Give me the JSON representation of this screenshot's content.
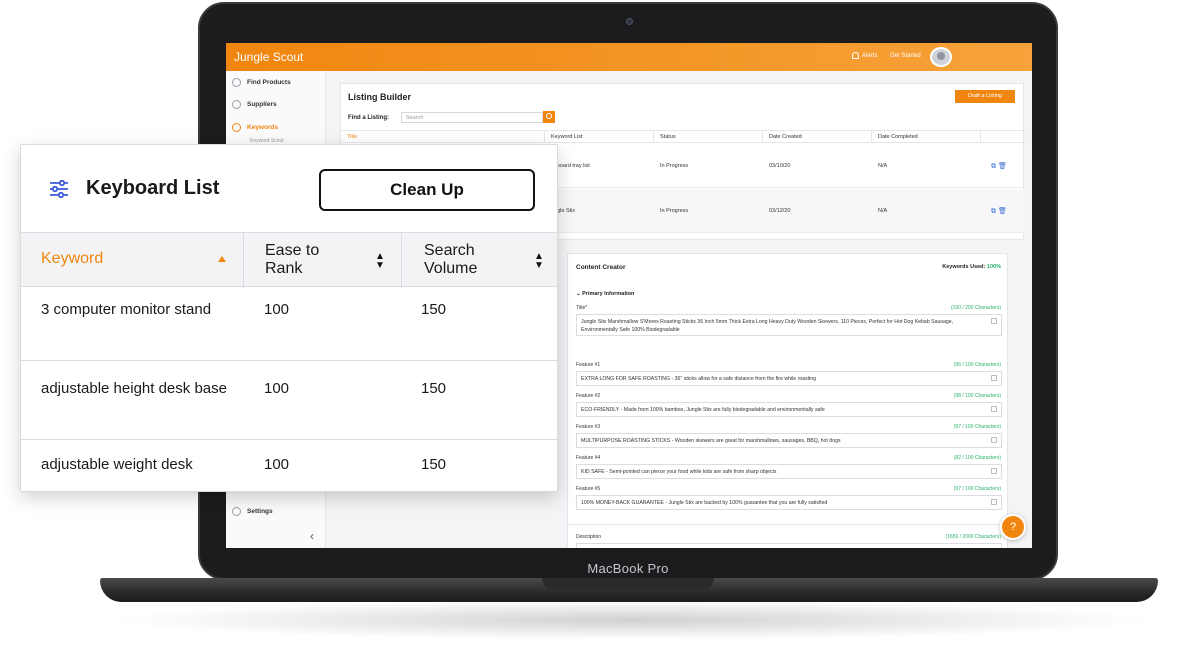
{
  "laptop": {
    "brand": "MacBook Pro"
  },
  "app": {
    "logo": "Jungle Scout",
    "topbar": {
      "alerts": "Alerts",
      "get_started": "Get Started"
    },
    "sidebar": {
      "items": [
        {
          "label": "Find Products",
          "icon": "search-icon"
        },
        {
          "label": "Suppliers",
          "icon": "tag-icon"
        },
        {
          "label": "Keywords",
          "icon": "key-icon"
        },
        {
          "label": "Settings",
          "icon": "gear-icon"
        }
      ],
      "sub_item": "Keyword Scout"
    },
    "listing_builder": {
      "title": "Listing Builder",
      "draft_button": "Draft a Listing",
      "find_label": "Find a Listing:",
      "search_placeholder": "Search",
      "columns": [
        "Title",
        "Keyword List",
        "Status",
        "Date Created",
        "Date Completed"
      ],
      "rows": [
        {
          "keyword_list": "eyboard tray list",
          "status": "In Progress",
          "date_created": "03/10/20",
          "date_completed": "N/A"
        },
        {
          "keyword_list": "ungle Stix",
          "status": "In Progress",
          "date_created": "03/12/20",
          "date_completed": "N/A"
        }
      ]
    },
    "content_creator": {
      "title": "Content Creator",
      "keywords_used_label": "Keywords Used:",
      "keywords_used_value": "100%",
      "section": "Primary Information",
      "fields": [
        {
          "label": "Title*",
          "count": "(190 / 200 Characters)",
          "text": "Jungle Stix Marshmallow S'Mores Roasting Sticks 36 Inch 5mm Thick Extra Long Heavy Duty Wooden Skewers, 110 Pieces, Perfect for Hot Dog Kebab Sausage, Environmentally Safe 100% Biodegradable"
        },
        {
          "label": "Feature #1",
          "count": "(96 / 100 Characters)",
          "text": "EXTRA LONG FOR SAFE ROASTING - 36\" sticks allow for a safe distance from the fire while roasting"
        },
        {
          "label": "Feature #2",
          "count": "(98 / 100 Characters)",
          "text": "ECO-FRIENDLY - Made from 100% bamboo, Jungle Stix are fully biodegradable and environmentally safe"
        },
        {
          "label": "Feature #3",
          "count": "(97 / 100 Characters)",
          "text": "MULTIPURPOSE ROASTING STICKS - Wooden skewers are great for marshmallows, sausages, BBQ, hot dogs"
        },
        {
          "label": "Feature #4",
          "count": "(82 / 100 Characters)",
          "text": "KID SAFE - Semi-pointed can pierce your food while kids are safe from sharp objects"
        },
        {
          "label": "Feature #5",
          "count": "(97 / 100 Characters)",
          "text": "100% MONEY-BACK GUARANTEE - Jungle Stix are backed by 100% guarantee that you are fully satisfied"
        },
        {
          "label": "Description",
          "count": "(1659 / 2000 Characters)",
          "text": ""
        }
      ]
    }
  },
  "overlay": {
    "title": "Keyboard List",
    "cleanup_button": "Clean Up",
    "columns": [
      "Keyword",
      "Ease to Rank",
      "Search Volume"
    ],
    "rows": [
      {
        "keyword": "3 computer monitor stand",
        "ease": "100",
        "volume": "150"
      },
      {
        "keyword": "adjustable height desk base",
        "ease": "100",
        "volume": "150"
      },
      {
        "keyword": "adjustable weight desk",
        "ease": "100",
        "volume": "150"
      }
    ]
  },
  "colors": {
    "accent": "#f0860f",
    "success": "#26b36a",
    "link": "#3b6fd4"
  }
}
